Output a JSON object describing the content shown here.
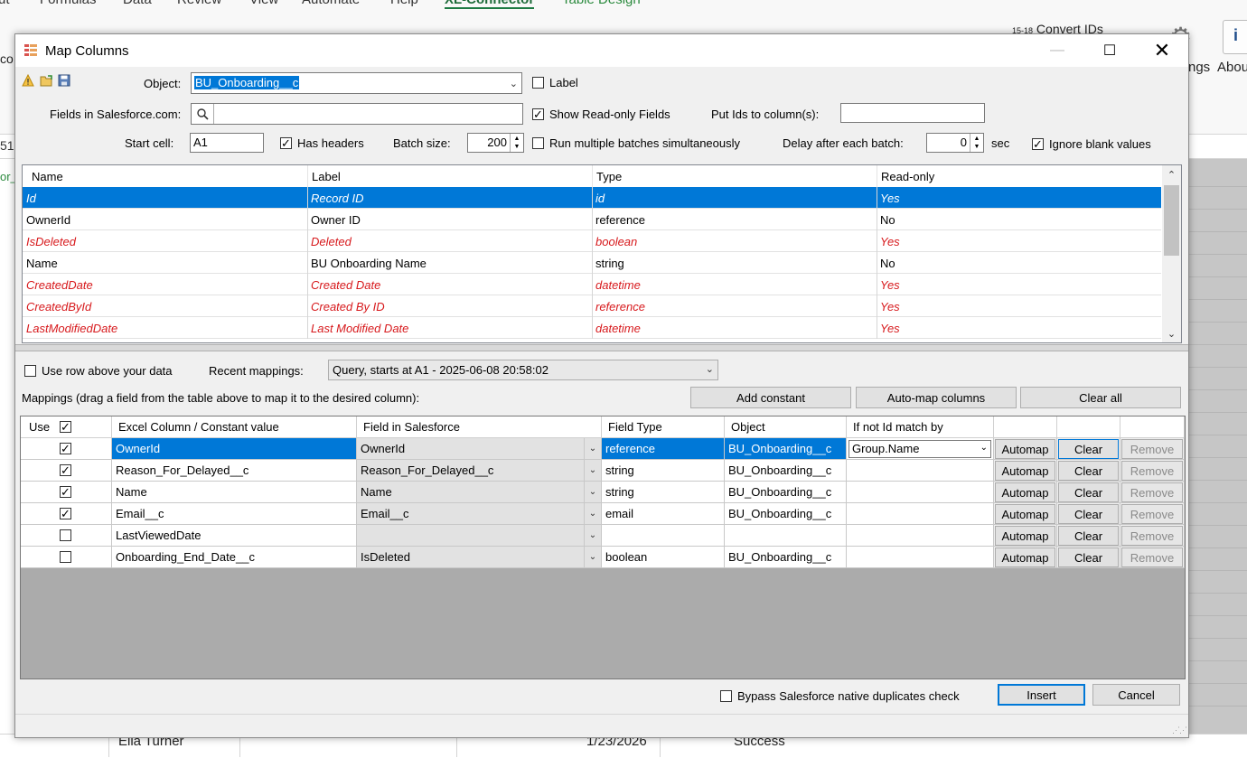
{
  "excel": {
    "tabs": [
      "ut",
      "Formulas",
      "Data",
      "Review",
      "View",
      "Automate",
      "Help",
      "XL-Connector",
      "Table Design"
    ],
    "convert_ids": "Convert IDs",
    "settings_label": "ngs",
    "about_label": "Abou",
    "name_box_partial": "co",
    "left_cell_partial": "51",
    "left_cell_partial2": "or_",
    "bottom_row": {
      "name": "Ella Turner",
      "date": "1/23/2026",
      "status": "Success"
    }
  },
  "dialog": {
    "title": "Map Columns",
    "controls": {
      "minimize": "—",
      "maximize": "☐",
      "close": "✕"
    },
    "object_label": "Object:",
    "object_value": "BU_Onboarding__c",
    "label_checkbox": "Label",
    "fields_label": "Fields in Salesforce.com:",
    "fields_search_value": "",
    "show_readonly_label": "Show Read-only Fields",
    "put_ids_label": "Put Ids to column(s):",
    "put_ids_value": "",
    "start_cell_label": "Start cell:",
    "start_cell_value": "A1",
    "has_headers_label": "Has headers",
    "batch_size_label": "Batch size:",
    "batch_size_value": "200",
    "run_multiple_label": "Run multiple batches simultaneously",
    "delay_label": "Delay after each batch:",
    "delay_value": "0",
    "delay_unit": "sec",
    "ignore_blank_label": "Ignore blank values",
    "checks": {
      "label": false,
      "show_readonly": true,
      "has_headers": true,
      "run_multiple": false,
      "ignore_blank": true,
      "use_row_above": false,
      "bypass": false
    },
    "fields_table": {
      "headers": [
        "Name",
        "Label",
        "Type",
        "Read-only"
      ],
      "rows": [
        {
          "name": "Id",
          "label": "Record ID",
          "type": "id",
          "readonly": "Yes"
        },
        {
          "name": "OwnerId",
          "label": "Owner ID",
          "type": "reference",
          "readonly": "No"
        },
        {
          "name": "IsDeleted",
          "label": "Deleted",
          "type": "boolean",
          "readonly": "Yes"
        },
        {
          "name": "Name",
          "label": "BU Onboarding Name",
          "type": "string",
          "readonly": "No"
        },
        {
          "name": "CreatedDate",
          "label": "Created Date",
          "type": "datetime",
          "readonly": "Yes"
        },
        {
          "name": "CreatedById",
          "label": "Created By ID",
          "type": "reference",
          "readonly": "Yes"
        },
        {
          "name": "LastModifiedDate",
          "label": "Last Modified Date",
          "type": "datetime",
          "readonly": "Yes"
        }
      ]
    },
    "use_row_above_label": "Use row above your data",
    "recent_mappings_label": "Recent mappings:",
    "recent_mappings_value": "Query, starts at A1 - 2025-06-08 20:58:02",
    "mappings_hint": "Mappings (drag a field from the table above to map it to the desired column):",
    "add_constant": "Add constant",
    "auto_map": "Auto-map columns",
    "clear_all": "Clear all",
    "mapping_grid": {
      "headers": [
        "Use",
        "Excel Column / Constant value",
        "Field in Salesforce",
        "Field Type",
        "Object",
        "If not Id match by"
      ],
      "automap_label": "Automap",
      "clear_label": "Clear",
      "remove_label": "Remove",
      "rows": [
        {
          "use": true,
          "excel": "OwnerId",
          "field": "OwnerId",
          "type": "reference",
          "object": "BU_Onboarding__c",
          "match": "Group.Name"
        },
        {
          "use": true,
          "excel": "Reason_For_Delayed__c",
          "field": "Reason_For_Delayed__c",
          "type": "string",
          "object": "BU_Onboarding__c",
          "match": ""
        },
        {
          "use": true,
          "excel": "Name",
          "field": "Name",
          "type": "string",
          "object": "BU_Onboarding__c",
          "match": ""
        },
        {
          "use": true,
          "excel": "Email__c",
          "field": "Email__c",
          "type": "email",
          "object": "BU_Onboarding__c",
          "match": ""
        },
        {
          "use": false,
          "excel": "LastViewedDate",
          "field": "",
          "type": "",
          "object": "",
          "match": ""
        },
        {
          "use": false,
          "excel": "Onboarding_End_Date__c",
          "field": "IsDeleted",
          "type": "boolean",
          "object": "BU_Onboarding__c",
          "match": ""
        }
      ]
    },
    "bypass_label": "Bypass Salesforce native duplicates check",
    "insert": "Insert",
    "cancel": "Cancel"
  }
}
